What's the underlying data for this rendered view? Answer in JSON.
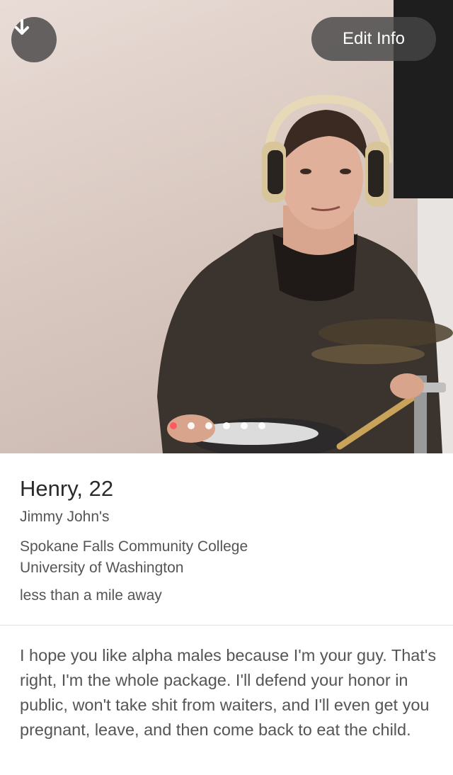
{
  "photo": {
    "down_button_icon": "arrow-down-icon",
    "edit_label": "Edit Info",
    "dot_count": 6,
    "active_dot": 0,
    "active_dot_color": "#ff5a5f"
  },
  "profile": {
    "name_age": "Henry, 22",
    "job": "Jimmy John's",
    "school_1": "Spokane Falls Community College",
    "school_2": "University of Washington",
    "distance": "less than a mile away"
  },
  "bio": {
    "text": "I hope you like alpha males because I'm your guy. That's right, I'm the whole package. I'll defend your honor in public, won't take shit from waiters, and I'll even get you pregnant, leave, and then come back to eat the child."
  }
}
